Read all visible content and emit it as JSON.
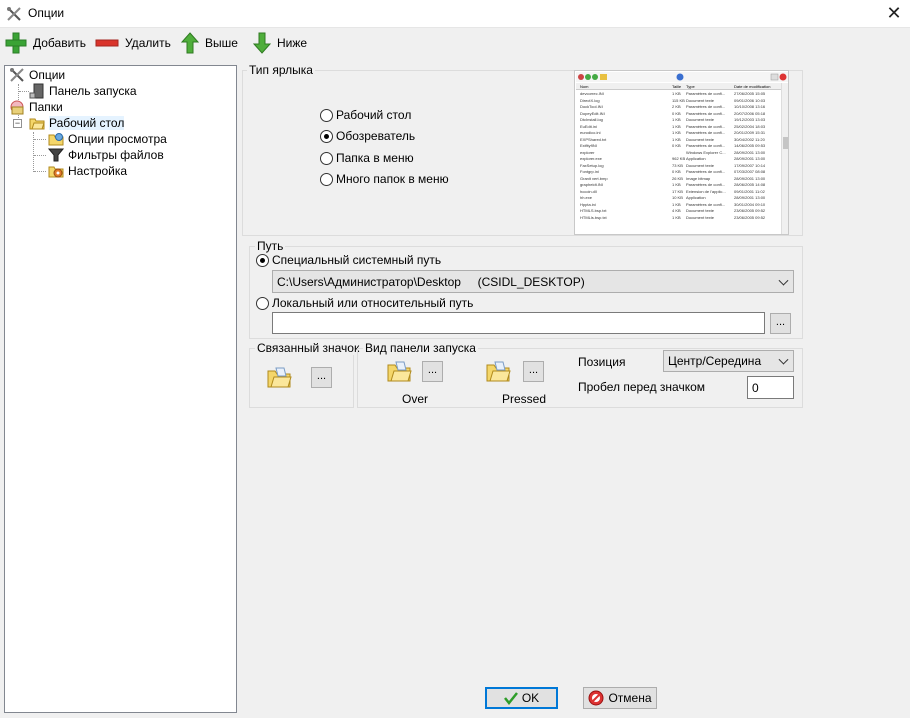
{
  "window": {
    "title": "Опции",
    "close_glyph": "✕"
  },
  "toolbar": {
    "add_label": "Добавить",
    "delete_label": "Удалить",
    "up_label": "Выше",
    "down_label": "Ниже"
  },
  "tree": {
    "items": [
      {
        "label": "Опции",
        "icon": "tools-icon"
      },
      {
        "label": "Панель запуска",
        "icon": "launch-panel-icon"
      },
      {
        "label": "Папки",
        "icon": "folders-icon"
      },
      {
        "label": "Рабочий стол",
        "icon": "desktop-folder-icon"
      },
      {
        "label": "Опции просмотра",
        "icon": "view-options-icon"
      },
      {
        "label": "Фильтры файлов",
        "icon": "filter-icon"
      },
      {
        "label": "Настройка",
        "icon": "settings-icon"
      }
    ],
    "expander_glyph": "−"
  },
  "shortcut_type": {
    "title": "Тип ярлыка",
    "options": [
      "Рабочий стол",
      "Обозреватель",
      "Папка в меню",
      "Много папок в меню"
    ],
    "selected": "Обозреватель"
  },
  "preview": {
    "headers": [
      "Nom",
      "Taille",
      "Type",
      "Date de modification"
    ],
    "rows": [
      [
        "devcorrec.INI",
        "1 KB",
        "Paramètres de confi...",
        "27/06/2005 15:05"
      ],
      [
        "DirectX.log",
        "115 KB",
        "Document texte",
        "09/01/2006 10:03"
      ],
      [
        "DockTool.INI",
        "2 KB",
        "Paramètres de confi...",
        "10/10/2008 13:16"
      ],
      [
        "DopeyEdit.INI",
        "0 KB",
        "Paramètres de confi...",
        "20/07/2006 05:18"
      ],
      [
        "DtcInstall.log",
        "1 KB",
        "Document texte",
        "19/12/2003 13:03"
      ],
      [
        "EuEdit.ini",
        "1 KB",
        "Paramètres de confi...",
        "25/02/2004 18:03"
      ],
      [
        "eurodico.ini",
        "1 KB",
        "Paramètres de confi...",
        "20/01/2009 15:31"
      ],
      [
        "EXPShared.txt",
        "1 KB",
        "Document texte",
        "30/04/2002 11:20"
      ],
      [
        "ExifityfINI",
        "0 KB",
        "Paramètres de confi...",
        "14/06/2005 09:53"
      ],
      [
        "explorer",
        "",
        "Windows Explorer C...",
        "28/09/2001 13:00"
      ],
      [
        "explorer.exe",
        "962 KB",
        "Application",
        "28/09/2001 13:00"
      ],
      [
        "FaxSetup.log",
        "73 KB",
        "Document texte",
        "17/09/2007 10:14"
      ],
      [
        "Fontgrp.ini",
        "0 KB",
        "Paramètres de confi...",
        "07/03/2007 08:08"
      ],
      [
        "Granit vert.bmp",
        "26 KB",
        "Image bitmap",
        "28/09/2001 13:00"
      ],
      [
        "grapheidt.INI",
        "1 KB",
        "Paramètres de confi...",
        "28/06/2005 14:08"
      ],
      [
        "hccoin.dll",
        "17 KB",
        "Extension de l'applic...",
        "09/01/2001 11:02"
      ],
      [
        "hh.exe",
        "10 KB",
        "Application",
        "28/09/2001 13:00"
      ],
      [
        "Hppta.ini",
        "1 KB",
        "Paramètres de confi...",
        "30/01/2004 09:10"
      ],
      [
        "HTMLS.bsp.txt",
        "4 KB",
        "Document texte",
        "23/06/2005 09:52"
      ],
      [
        "HTMLls.bsp.txt",
        "1 KB",
        "Document texte",
        "23/06/2005 09:52"
      ]
    ]
  },
  "path": {
    "title": "Путь",
    "special_label": "Специальный системный путь",
    "special_value": "C:\\Users\\Администратор\\Desktop     (CSIDL_DESKTOP)",
    "local_label": "Локальный или относительный путь",
    "local_value": "",
    "browse_label": "...",
    "selected": "special"
  },
  "linked_icon": {
    "title": "Связанный значок",
    "browse_label": "..."
  },
  "launch_view": {
    "title": "Вид панели запуска",
    "over_label": "Over",
    "pressed_label": "Pressed",
    "browse_label": "...",
    "position_label": "Позиция",
    "position_value": "Центр/Середина",
    "spacing_label": "Пробел перед значком",
    "spacing_value": "0"
  },
  "footer": {
    "ok_label": "OK",
    "cancel_label": "Отмена"
  },
  "colors": {
    "accent": "#0078d7",
    "add_green": "#3aa335",
    "delete_red": "#d9342b",
    "arrow_green": "#4fae3b"
  }
}
